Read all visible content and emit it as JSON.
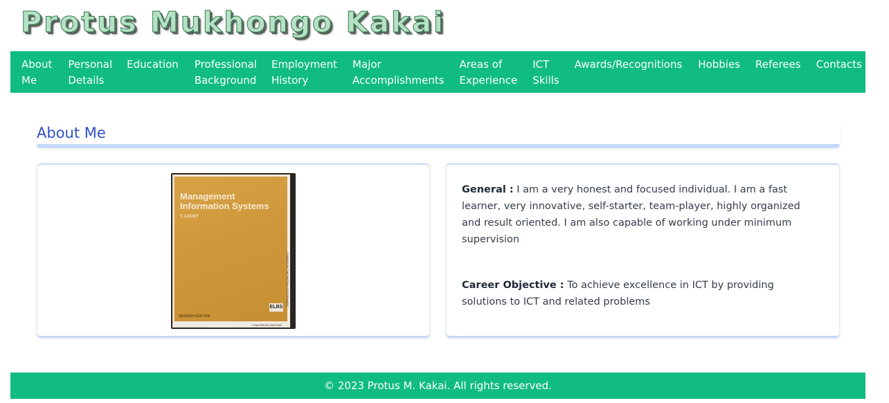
{
  "site": {
    "title": "Protus Mukhongo Kakai"
  },
  "nav": {
    "items": [
      {
        "line1": "About",
        "line2": "Me"
      },
      {
        "line1": "Personal",
        "line2": "Details"
      },
      {
        "line1": "Education",
        "line2": ""
      },
      {
        "line1": "Professional",
        "line2": "Background"
      },
      {
        "line1": "Employment",
        "line2": "History"
      },
      {
        "line1": "Major",
        "line2": "Accomplishments"
      },
      {
        "line1": "Areas of",
        "line2": "Experience"
      },
      {
        "line1": "ICT",
        "line2": "Skills"
      },
      {
        "line1": "Awards/Recognitions",
        "line2": ""
      },
      {
        "line1": "Hobbies",
        "line2": ""
      },
      {
        "line1": "Referees",
        "line2": ""
      },
      {
        "line1": "Contacts",
        "line2": ""
      }
    ]
  },
  "section": {
    "heading": "About Me"
  },
  "book": {
    "title_line1": "Management",
    "title_line2": "Information Systems",
    "author": "T. LUCEY",
    "edition": "SEVENTH EDITION",
    "publisher_logo": "ELBS",
    "spine_text": "FUNDED BY THE BRITISH GOVERNMENT",
    "low_price": "LOW-PRICED EDITION"
  },
  "about": {
    "general_label": "General :",
    "general_text": " I am a very honest and focused individual. I am a fast learner, very innovative, self-starter, team-player, highly organized and result oriented. I am also capable of working under minimum supervision",
    "career_label": "Career Objective :",
    "career_text": " To achieve excellence in ICT by providing solutions to ICT and related problems"
  },
  "footer": {
    "text": "© 2023 Protus M. Kakai. All rights reserved."
  },
  "colors": {
    "brand_green": "#10bc80",
    "heading_blue": "#2f50c4",
    "accent_light_blue": "#c4d8f8"
  }
}
